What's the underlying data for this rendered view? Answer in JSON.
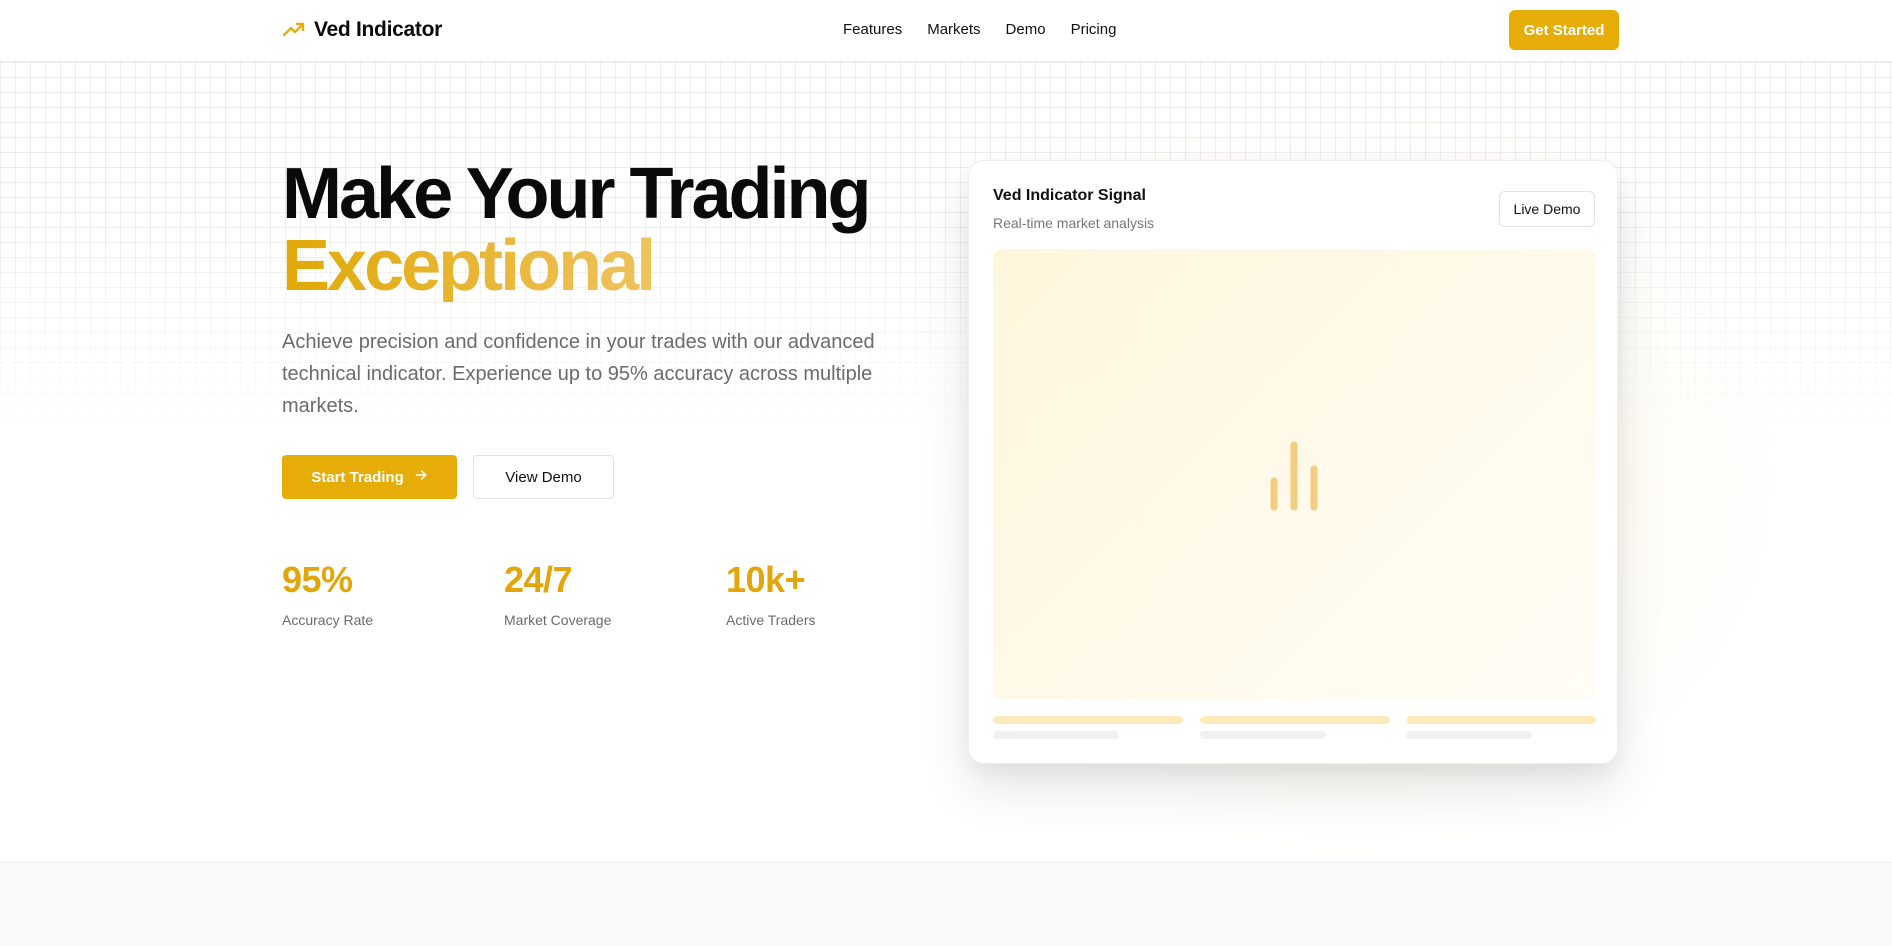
{
  "nav": {
    "brand": "Ved Indicator",
    "links": [
      "Features",
      "Markets",
      "Demo",
      "Pricing"
    ],
    "cta": "Get Started"
  },
  "hero": {
    "headline_line1": "Make Your Trading",
    "headline_line2": "Exceptional",
    "subtitle": "Achieve precision and confidence in your trades with our advanced technical indicator. Experience up to 95% accuracy across multiple markets.",
    "primary_button": "Start Trading",
    "primary_button_icon": "arrow-right-icon",
    "secondary_button": "View Demo",
    "stats": [
      {
        "value": "95%",
        "label": "Accuracy Rate"
      },
      {
        "value": "24/7",
        "label": "Market Coverage"
      },
      {
        "value": "10k+",
        "label": "Active Traders"
      }
    ]
  },
  "card": {
    "title": "Ved Indicator Signal",
    "subtitle": "Real-time market analysis",
    "button": "Live Demo",
    "placeholder_icon": "bar-chart-icon"
  },
  "colors": {
    "accent": "#e6ad09",
    "accent_light": "#f6d88c",
    "text_primary": "#0a0a0a",
    "text_muted": "#6b6b6b",
    "card_chart_bg": "#fff6dc"
  }
}
